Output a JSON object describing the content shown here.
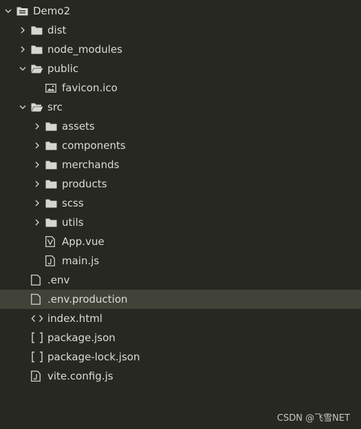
{
  "tree": {
    "root": {
      "label": "Demo2",
      "icon": "project-folder-icon",
      "expanded": true
    },
    "items": [
      {
        "label": "dist",
        "icon": "folder-icon",
        "expanded": false
      },
      {
        "label": "node_modules",
        "icon": "folder-icon",
        "expanded": false
      },
      {
        "label": "public",
        "icon": "folder-open-icon",
        "expanded": true
      },
      {
        "label": "favicon.ico",
        "icon": "image-file-icon"
      },
      {
        "label": "src",
        "icon": "folder-open-icon",
        "expanded": true
      },
      {
        "label": "assets",
        "icon": "folder-icon",
        "expanded": false
      },
      {
        "label": "components",
        "icon": "folder-icon",
        "expanded": false
      },
      {
        "label": "merchands",
        "icon": "folder-icon",
        "expanded": false
      },
      {
        "label": "products",
        "icon": "folder-icon",
        "expanded": false
      },
      {
        "label": "scss",
        "icon": "folder-icon",
        "expanded": false
      },
      {
        "label": "utils",
        "icon": "folder-icon",
        "expanded": false
      },
      {
        "label": "App.vue",
        "icon": "vue-file-icon"
      },
      {
        "label": "main.js",
        "icon": "js-file-icon"
      },
      {
        "label": ".env",
        "icon": "file-icon"
      },
      {
        "label": ".env.production",
        "icon": "file-icon",
        "selected": true
      },
      {
        "label": "index.html",
        "icon": "html-file-icon"
      },
      {
        "label": "package.json",
        "icon": "json-file-icon"
      },
      {
        "label": "package-lock.json",
        "icon": "json-file-icon"
      },
      {
        "label": "vite.config.js",
        "icon": "js-file-icon"
      }
    ]
  },
  "watermark": "CSDN @飞雪NET",
  "colors": {
    "background": "#272822",
    "selected_row": "#414339",
    "text": "#dcdcd6",
    "icon": "#d6d6d0"
  }
}
